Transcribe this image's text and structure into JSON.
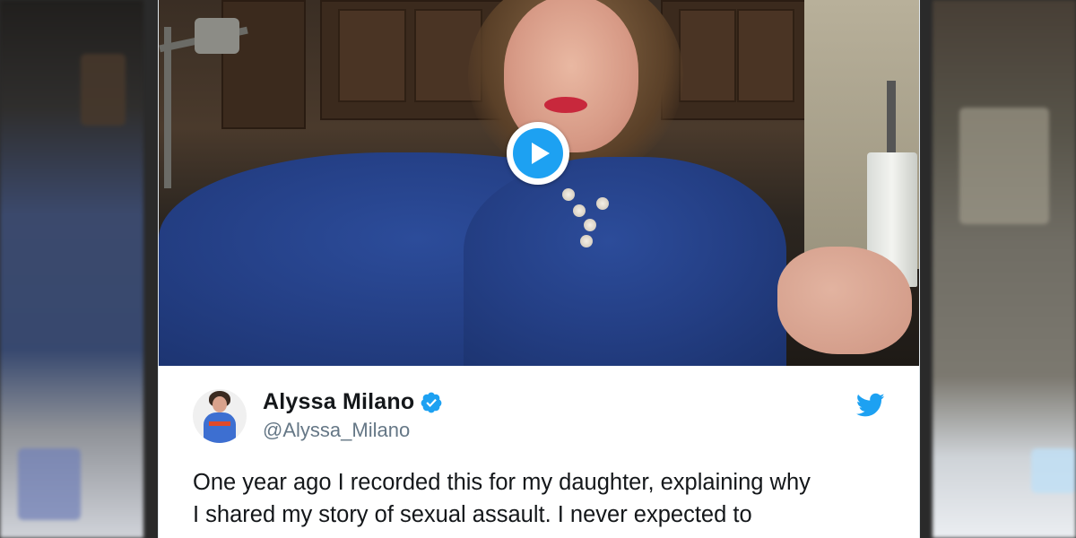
{
  "tweet": {
    "display_name": "Alyssa Milano",
    "handle": "@Alyssa_Milano",
    "text_line1": "One year ago I recorded this for my daughter, explaining why",
    "text_line2": "I shared my story of sexual assault. I never expected to"
  },
  "icons": {
    "play": "play-icon",
    "verified": "verified-badge-icon",
    "brand": "twitter-bird-icon"
  },
  "colors": {
    "brand_blue": "#1da1f2",
    "name_text": "#14171a",
    "handle_text": "#657786",
    "card_bg": "#ffffff"
  }
}
